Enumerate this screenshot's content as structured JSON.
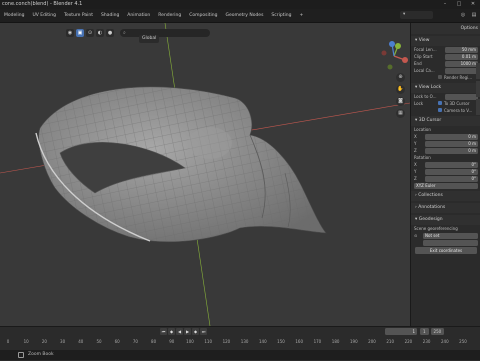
{
  "window": {
    "title": "cone.conch(blend) - Blender 4.1"
  },
  "tabs": [
    "Modeling",
    "UV Editing",
    "Texture Paint",
    "Shading",
    "Animation",
    "Rendering",
    "Compositing",
    "Geometry Nodes",
    "Scripting",
    "+"
  ],
  "viewport": {
    "orientation": "Global",
    "search_placeholder": "",
    "colors": {
      "x_axis": "#c4584f",
      "y_axis": "#88b33a",
      "z_axis": "#4c7fd0",
      "mesh": "#8d8d8d",
      "wire": "#5c5c5c"
    }
  },
  "npanel": {
    "options_label": "Options",
    "view_section": "View",
    "focal_length_label": "Focal Len...",
    "focal_length_value": "50 mm",
    "clip_start_label": "Clip Start",
    "clip_start_value": "0.01 m",
    "clip_end_label": "End",
    "clip_end_value": "1000 m",
    "local_camera_label": "Local Ca...",
    "render_region_label": "Render Regi...",
    "view_lock_section": "View Lock",
    "lock_to_object_label": "Lock to O...",
    "lock_label": "Lock",
    "to_3d_cursor_label": "To 3D Cursor",
    "camera_to_view_label": "Camera to V...",
    "cursor_section": "3D Cursor",
    "location_label": "Location",
    "x_label": "X",
    "y_label": "Y",
    "z_label": "Z",
    "loc_x": "0 m",
    "loc_y": "0 m",
    "loc_z": "0 m",
    "rotation_label": "Rotation",
    "rot_x": "0°",
    "rot_y": "0°",
    "rot_z": "0°",
    "rotation_mode": "XYZ Euler",
    "collections_section": "Collections",
    "annotations_section": "Annotations",
    "geodesign_section": "Geodesign",
    "scene_georef_label": "Scene georeferencing",
    "not_set_label": "Not set",
    "exit_coords_label": "Exit coordinates"
  },
  "timeline": {
    "current_frame": "1",
    "start": "Start",
    "start_value": "1",
    "end_label": "End",
    "end_value": "250",
    "ticks": [
      "0",
      "10",
      "20",
      "30",
      "40",
      "50",
      "60",
      "70",
      "80",
      "90",
      "100",
      "110",
      "120",
      "130",
      "140",
      "150",
      "160",
      "170",
      "180",
      "190",
      "200",
      "210",
      "220",
      "230",
      "240",
      "250"
    ]
  },
  "status": {
    "text": "Zoom Book"
  }
}
